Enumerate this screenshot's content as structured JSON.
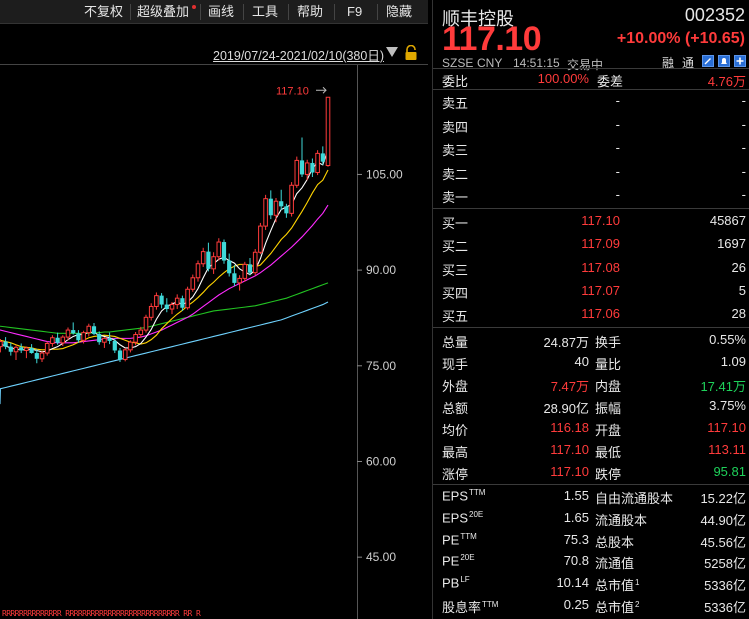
{
  "toolbar": {
    "items": [
      "不复权",
      "超级叠加",
      "画线",
      "工具",
      "帮助",
      "F9",
      "隐藏"
    ]
  },
  "chart": {
    "date_range": "2019/07/24-2021/02/10(380日)",
    "price_labels": [
      "105.00",
      "90.00",
      "75.00",
      "60.00",
      "45.00"
    ],
    "high_marker": "117.10",
    "bottom_marks": "RRRRRRRRRRRRRR RRRRRRRRRRRRRRRRRRRRRRRRRRR RR R"
  },
  "chart_data": {
    "type": "candlestick",
    "ylim": [
      37.5,
      122
    ],
    "yticks": [
      105,
      90,
      75,
      60,
      45
    ],
    "colors": {
      "up": "#ff3b3b",
      "down": "#3fd9d9",
      "ma5": "#ffffff",
      "ma10": "#ffd400",
      "ma20": "#ff2bff",
      "ma60": "#22c322",
      "ma120": "#6fd3ff"
    },
    "candles": [
      [
        78.0,
        79.2,
        77.1,
        78.8
      ],
      [
        78.8,
        79.5,
        77.6,
        78.0
      ],
      [
        78.0,
        78.6,
        76.6,
        77.2
      ],
      [
        77.2,
        78.3,
        75.9,
        77.9
      ],
      [
        77.9,
        78.5,
        77.0,
        77.4
      ],
      [
        77.4,
        78.0,
        76.2,
        77.8
      ],
      [
        77.8,
        78.4,
        76.9,
        77.0
      ],
      [
        77.0,
        77.6,
        75.4,
        76.1
      ],
      [
        76.1,
        77.3,
        75.6,
        77.0
      ],
      [
        77.0,
        78.8,
        76.6,
        78.5
      ],
      [
        78.5,
        79.8,
        78.0,
        79.4
      ],
      [
        79.4,
        80.2,
        78.3,
        78.6
      ],
      [
        78.6,
        79.8,
        78.1,
        79.5
      ],
      [
        79.5,
        81.0,
        79.0,
        80.6
      ],
      [
        80.6,
        81.8,
        79.9,
        80.1
      ],
      [
        80.1,
        80.6,
        78.6,
        79.0
      ],
      [
        79.0,
        80.5,
        78.5,
        80.2
      ],
      [
        80.2,
        81.6,
        79.6,
        81.2
      ],
      [
        81.2,
        81.7,
        79.8,
        80.0
      ],
      [
        80.0,
        80.4,
        78.3,
        78.7
      ],
      [
        78.7,
        79.5,
        77.8,
        79.3
      ],
      [
        79.3,
        80.2,
        78.4,
        78.9
      ],
      [
        78.9,
        79.3,
        77.0,
        77.4
      ],
      [
        77.4,
        77.8,
        75.6,
        76.0
      ],
      [
        76.0,
        77.8,
        75.7,
        77.5
      ],
      [
        77.5,
        79.0,
        77.1,
        78.7
      ],
      [
        78.7,
        80.3,
        78.2,
        79.9
      ],
      [
        79.9,
        81.1,
        79.4,
        80.6
      ],
      [
        80.6,
        83.0,
        80.2,
        82.6
      ],
      [
        82.6,
        84.8,
        82.1,
        84.3
      ],
      [
        84.3,
        86.5,
        83.8,
        86.0
      ],
      [
        86.0,
        86.4,
        84.0,
        84.6
      ],
      [
        84.6,
        85.6,
        83.4,
        83.9
      ],
      [
        83.9,
        85.0,
        83.1,
        84.6
      ],
      [
        84.6,
        86.2,
        83.9,
        85.6
      ],
      [
        85.6,
        86.0,
        83.6,
        84.1
      ],
      [
        84.1,
        87.4,
        83.8,
        87.0
      ],
      [
        87.0,
        89.3,
        86.6,
        88.8
      ],
      [
        88.8,
        91.5,
        88.2,
        91.0
      ],
      [
        91.0,
        93.5,
        90.5,
        92.9
      ],
      [
        92.9,
        94.3,
        89.8,
        90.2
      ],
      [
        90.2,
        92.8,
        89.4,
        92.1
      ],
      [
        92.1,
        95.0,
        91.5,
        94.4
      ],
      [
        94.4,
        94.8,
        91.0,
        91.5
      ],
      [
        91.5,
        92.6,
        89.0,
        89.5
      ],
      [
        89.5,
        90.8,
        87.5,
        88.0
      ],
      [
        88.0,
        89.2,
        86.8,
        88.7
      ],
      [
        88.7,
        91.3,
        88.2,
        90.9
      ],
      [
        90.9,
        91.9,
        89.2,
        89.6
      ],
      [
        89.6,
        93.3,
        89.2,
        92.8
      ],
      [
        92.8,
        97.4,
        92.5,
        96.9
      ],
      [
        96.9,
        101.8,
        96.3,
        101.2
      ],
      [
        101.2,
        102.5,
        98.0,
        98.6
      ],
      [
        98.6,
        101.3,
        97.5,
        100.8
      ],
      [
        100.8,
        102.6,
        99.4,
        100.0
      ],
      [
        100.0,
        100.4,
        98.2,
        98.9
      ],
      [
        98.9,
        103.8,
        98.4,
        103.3
      ],
      [
        103.3,
        107.8,
        102.9,
        107.2
      ],
      [
        107.2,
        110.8,
        104.6,
        105.0
      ],
      [
        105.0,
        107.3,
        104.1,
        106.8
      ],
      [
        106.8,
        107.5,
        104.6,
        105.3
      ],
      [
        105.3,
        108.8,
        104.9,
        108.3
      ],
      [
        108.3,
        109.4,
        106.5,
        107.0
      ],
      [
        106.4,
        117.1,
        106.2,
        117.1
      ]
    ],
    "ma5": [
      78.4,
      78.1,
      77.8,
      77.6,
      77.5,
      77.5,
      77.6,
      77.4,
      77.2,
      77.3,
      77.7,
      78.0,
      78.5,
      79.1,
      79.6,
      79.9,
      79.9,
      80.3,
      80.2,
      79.8,
      79.6,
      79.4,
      79.0,
      78.3,
      77.8,
      77.8,
      78.0,
      78.5,
      79.5,
      80.7,
      82.3,
      83.6,
      84.3,
      84.7,
      85.0,
      84.6,
      85.0,
      85.8,
      87.1,
      88.8,
      90.4,
      91.0,
      91.7,
      92.0,
      91.5,
      91.1,
      90.2,
      89.7,
      89.3,
      90.0,
      91.8,
      94.2,
      96.2,
      98.1,
      99.5,
      99.9,
      100.3,
      102.0,
      102.9,
      104.2,
      105.9,
      106.9,
      106.5,
      108.9
    ],
    "ma10": [
      79.0,
      78.8,
      78.6,
      78.3,
      78.0,
      77.9,
      77.8,
      77.6,
      77.5,
      77.5,
      77.6,
      77.6,
      77.7,
      78.0,
      78.3,
      78.7,
      79.0,
      79.4,
      79.6,
      79.7,
      79.8,
      79.7,
      79.6,
      79.3,
      79.0,
      78.7,
      78.6,
      78.4,
      78.6,
      79.1,
      79.8,
      80.8,
      81.6,
      82.4,
      83.1,
      83.7,
      84.4,
      85.0,
      85.7,
      86.5,
      87.4,
      88.1,
      88.9,
      89.6,
      90.2,
      90.6,
      90.9,
      90.9,
      90.8,
      90.5,
      90.8,
      91.7,
      92.6,
      93.7,
      94.8,
      95.6,
      96.6,
      97.9,
      99.2,
      100.6,
      102.1,
      103.4,
      104.1,
      105.7
    ],
    "ma20": [
      80.6,
      80.4,
      80.2,
      80.0,
      79.8,
      79.6,
      79.4,
      79.2,
      79.0,
      78.8,
      78.7,
      78.6,
      78.6,
      78.6,
      78.6,
      78.7,
      78.8,
      78.9,
      79.0,
      79.1,
      79.2,
      79.3,
      79.3,
      79.3,
      79.3,
      79.3,
      79.4,
      79.5,
      79.7,
      80.0,
      80.3,
      80.6,
      81.0,
      81.4,
      81.8,
      82.2,
      82.6,
      83.1,
      83.7,
      84.3,
      84.9,
      85.5,
      86.1,
      86.6,
      87.1,
      87.5,
      87.9,
      88.3,
      88.7,
      89.1,
      89.6,
      90.2,
      90.8,
      91.5,
      92.2,
      92.9,
      93.6,
      94.4,
      95.2,
      96.1,
      97.0,
      98.0,
      98.9,
      100.2
    ],
    "ma60": [
      81.2,
      81.1,
      81.0,
      80.9,
      80.8,
      80.7,
      80.6,
      80.5,
      80.4,
      80.3,
      80.2,
      80.1,
      80.1,
      80.1,
      80.1,
      80.1,
      80.1,
      80.1,
      80.2,
      80.2,
      80.3,
      80.3,
      80.4,
      80.5,
      80.6,
      80.7,
      80.8,
      80.9,
      81.0,
      81.2,
      81.4,
      81.6,
      81.8,
      82.0,
      82.2,
      82.4,
      82.6,
      82.8,
      83.0,
      83.2,
      83.4,
      83.6,
      83.7,
      83.8,
      83.9,
      84.0,
      84.1,
      84.2,
      84.3,
      84.4,
      84.6,
      84.8,
      85.0,
      85.2,
      85.4,
      85.6,
      85.9,
      86.2,
      86.5,
      86.8,
      87.1,
      87.4,
      87.7,
      88.0
    ],
    "ma120": [
      71.4,
      71.6,
      71.8,
      72.0,
      72.2,
      72.4,
      72.6,
      72.8,
      73.0,
      73.2,
      73.4,
      73.6,
      73.8,
      74.0,
      74.2,
      74.4,
      74.6,
      74.8,
      75.0,
      75.2,
      75.4,
      75.6,
      75.8,
      76.0,
      76.2,
      76.4,
      76.6,
      76.8,
      77.0,
      77.2,
      77.4,
      77.6,
      77.8,
      78.0,
      78.2,
      78.4,
      78.6,
      78.8,
      79.0,
      79.2,
      79.4,
      79.6,
      79.8,
      80.0,
      80.2,
      80.4,
      80.6,
      80.8,
      81.0,
      81.2,
      81.4,
      81.6,
      81.8,
      82.0,
      82.2,
      82.5,
      82.8,
      83.1,
      83.4,
      83.7,
      84.0,
      84.3,
      84.6,
      85.0
    ]
  },
  "quote": {
    "name": "顺丰控股",
    "code": "002352",
    "price": "117.10",
    "change": "+10.00% (+10.65)",
    "exchange": "SZSE",
    "currency": "CNY",
    "time": "14:51:15",
    "status": "交易中",
    "badge1": "融",
    "badge2": "通",
    "weibi_label": "委比",
    "weibi_value": "100.00%",
    "weicha_label": "委差",
    "weicha_value": "4.76万",
    "asks": [
      {
        "label": "卖五",
        "price": "-",
        "vol": "-"
      },
      {
        "label": "卖四",
        "price": "-",
        "vol": "-"
      },
      {
        "label": "卖三",
        "price": "-",
        "vol": "-"
      },
      {
        "label": "卖二",
        "price": "-",
        "vol": "-"
      },
      {
        "label": "卖一",
        "price": "-",
        "vol": "-"
      }
    ],
    "bids": [
      {
        "label": "买一",
        "price": "117.10",
        "vol": "45867"
      },
      {
        "label": "买二",
        "price": "117.09",
        "vol": "1697"
      },
      {
        "label": "买三",
        "price": "117.08",
        "vol": "26"
      },
      {
        "label": "买四",
        "price": "117.07",
        "vol": "5"
      },
      {
        "label": "买五",
        "price": "117.06",
        "vol": "28"
      }
    ],
    "stats": [
      {
        "l1": "总量",
        "v1": "24.87万",
        "c1": "white",
        "l2": "换手",
        "v2": "0.55%",
        "c2": "white"
      },
      {
        "l1": "现手",
        "v1": "40",
        "c1": "white",
        "l2": "量比",
        "v2": "1.09",
        "c2": "white"
      },
      {
        "l1": "外盘",
        "v1": "7.47万",
        "c1": "red",
        "l2": "内盘",
        "v2": "17.41万",
        "c2": "green"
      },
      {
        "l1": "总额",
        "v1": "28.90亿",
        "c1": "white",
        "l2": "振幅",
        "v2": "3.75%",
        "c2": "white"
      },
      {
        "l1": "均价",
        "v1": "116.18",
        "c1": "red",
        "l2": "开盘",
        "v2": "117.10",
        "c2": "red"
      },
      {
        "l1": "最高",
        "v1": "117.10",
        "c1": "red",
        "l2": "最低",
        "v2": "113.11",
        "c2": "red"
      },
      {
        "l1": "涨停",
        "v1": "117.10",
        "c1": "red",
        "l2": "跌停",
        "v2": "95.81",
        "c2": "green"
      }
    ],
    "fundamentals": [
      {
        "l1": "EPS",
        "s1": "TTM",
        "v1": "1.55",
        "l2": "自由流通股本",
        "s2": "",
        "v2": "15.22亿"
      },
      {
        "l1": "EPS",
        "s1": "20E",
        "v1": "1.65",
        "l2": "流通股本",
        "s2": "",
        "v2": "44.90亿"
      },
      {
        "l1": "PE",
        "s1": "TTM",
        "v1": "75.3",
        "l2": "总股本",
        "s2": "",
        "v2": "45.56亿"
      },
      {
        "l1": "PE",
        "s1": "20E",
        "v1": "70.8",
        "l2": "流通值",
        "s2": "",
        "v2": "5258亿"
      },
      {
        "l1": "PB",
        "s1": "LF",
        "v1": "10.14",
        "l2": "总市值",
        "s2": "1",
        "v2": "5336亿"
      },
      {
        "l1": "股息率",
        "s1": "TTM",
        "v1": "0.25",
        "l2": "总市值",
        "s2": "2",
        "v2": "5336亿"
      }
    ]
  }
}
